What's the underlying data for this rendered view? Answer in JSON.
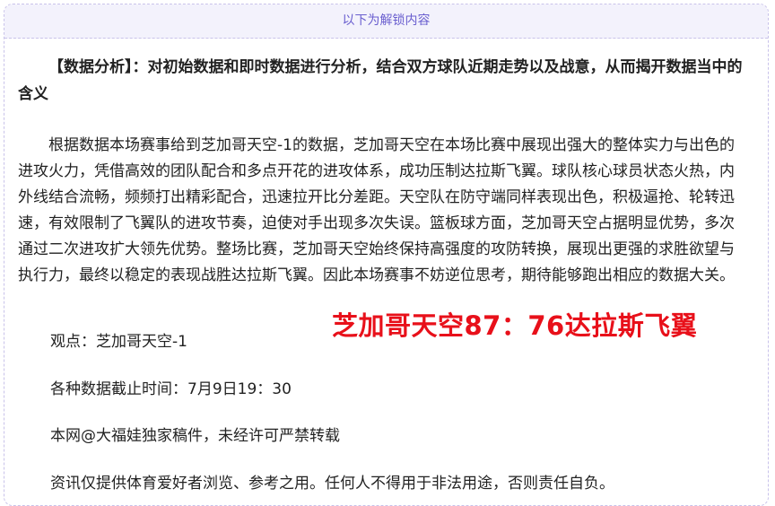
{
  "unlock_bar": {
    "label": "以下为解锁内容"
  },
  "article": {
    "heading": "【数据分析】：对初始数据和即时数据进行分析，结合双方球队近期走势以及战意，从而揭开数据当中的含义",
    "body": "根据数据本场赛事给到芝加哥天空-1的数据，芝加哥天空在本场比赛中展现出强大的整体实力与出色的进攻火力，凭借高效的团队配合和多点开花的进攻体系，成功压制达拉斯飞翼。球队核心球员状态火热，内外线结合流畅，频频打出精彩配合，迅速拉开比分差距。天空队在防守端同样表现出色，积极逼抢、轮转迅速，有效限制了飞翼队的进攻节奏，迫使对手出现多次失误。篮板球方面，芝加哥天空占据明显优势，多次通过二次进攻扩大领先优势。整场比赛，芝加哥天空始终保持高强度的攻防转换，展现出更强的求胜欲望与执行力，最终以稳定的表现战胜达拉斯飞翼。因此本场赛事不妨逆位思考，期待能够跑出相应的数据大关。",
    "viewpoint": "观点：芝加哥天空-1",
    "score_prediction": "芝加哥天空87：76达拉斯飞翼",
    "cutoff": "各种数据截止时间：7月9日19：30",
    "copyright": "本网@大福娃独家稿件，未经许可严禁转载",
    "disclaimer": "资讯仅提供体育爱好者浏览、参考之用。任何人不得用于非法用途，否则责任自负。"
  },
  "colors": {
    "accent": "#6a5fcf",
    "border": "#c8c2ea",
    "score": "#e8101a",
    "bar_bg": "#f3f2fc"
  }
}
